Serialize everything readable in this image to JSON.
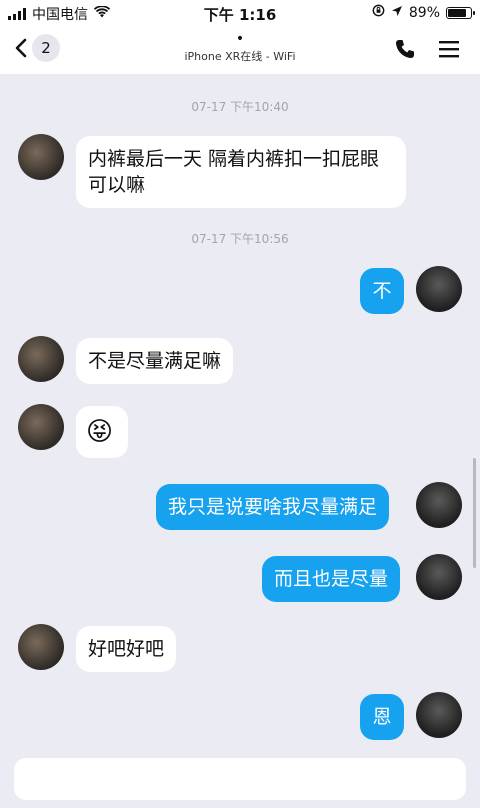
{
  "status_bar": {
    "carrier": "中国电信",
    "time": "下午 1:16",
    "battery": "89%",
    "battery_level": 0.89
  },
  "nav": {
    "back_count": "2",
    "title_dot": "•",
    "subtitle": "iPhone XR在线 - WiFi"
  },
  "timestamps": [
    "07-17 下午10:40",
    "07-17 下午10:56"
  ],
  "messages": [
    {
      "from": "them",
      "text": "内裤最后一天 隔着内裤扣一扣屁眼可以嘛"
    },
    {
      "from": "me",
      "text": "不"
    },
    {
      "from": "them",
      "text": "不是尽量满足嘛"
    },
    {
      "from": "them",
      "text": "😝"
    },
    {
      "from": "me",
      "text": "我只是说要啥我尽量满足"
    },
    {
      "from": "me",
      "text": "而且也是尽量"
    },
    {
      "from": "them",
      "text": "好吧好吧"
    },
    {
      "from": "me",
      "text": "恩"
    }
  ],
  "input": {
    "value": "",
    "placeholder": ""
  }
}
